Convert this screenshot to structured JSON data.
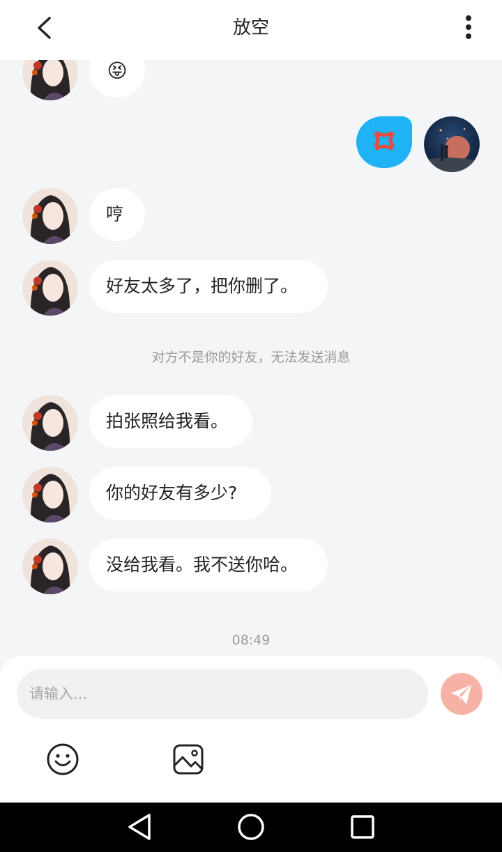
{
  "header": {
    "title": "放空"
  },
  "messages": [
    {
      "sender": "contact",
      "content_type": "emoji",
      "emoji": "😝"
    },
    {
      "sender": "me",
      "content_type": "emoji",
      "emoji": "💢"
    },
    {
      "sender": "contact",
      "content_type": "text",
      "text": "哼"
    },
    {
      "sender": "contact",
      "content_type": "text",
      "text": "好友太多了，把你删了。"
    },
    {
      "sender": "system",
      "text": "对方不是你的好友，无法发送消息"
    },
    {
      "sender": "contact",
      "content_type": "text",
      "text": "拍张照给我看。"
    },
    {
      "sender": "contact",
      "content_type": "text",
      "text": "你的好友有多少?"
    },
    {
      "sender": "contact",
      "content_type": "text",
      "text": "没给我看。我不送你哈。"
    }
  ],
  "timestamp": "08:49",
  "composer": {
    "placeholder": "请输入...",
    "value": ""
  },
  "colors": {
    "my_bubble": "#1fb2f5",
    "send_button": "#f6b3a5",
    "background": "#f4f5f7"
  },
  "icons": {
    "back": "chevron-left-icon",
    "more": "more-vertical-icon",
    "send": "paper-plane-icon",
    "emoji": "smiley-icon",
    "image": "image-icon"
  }
}
